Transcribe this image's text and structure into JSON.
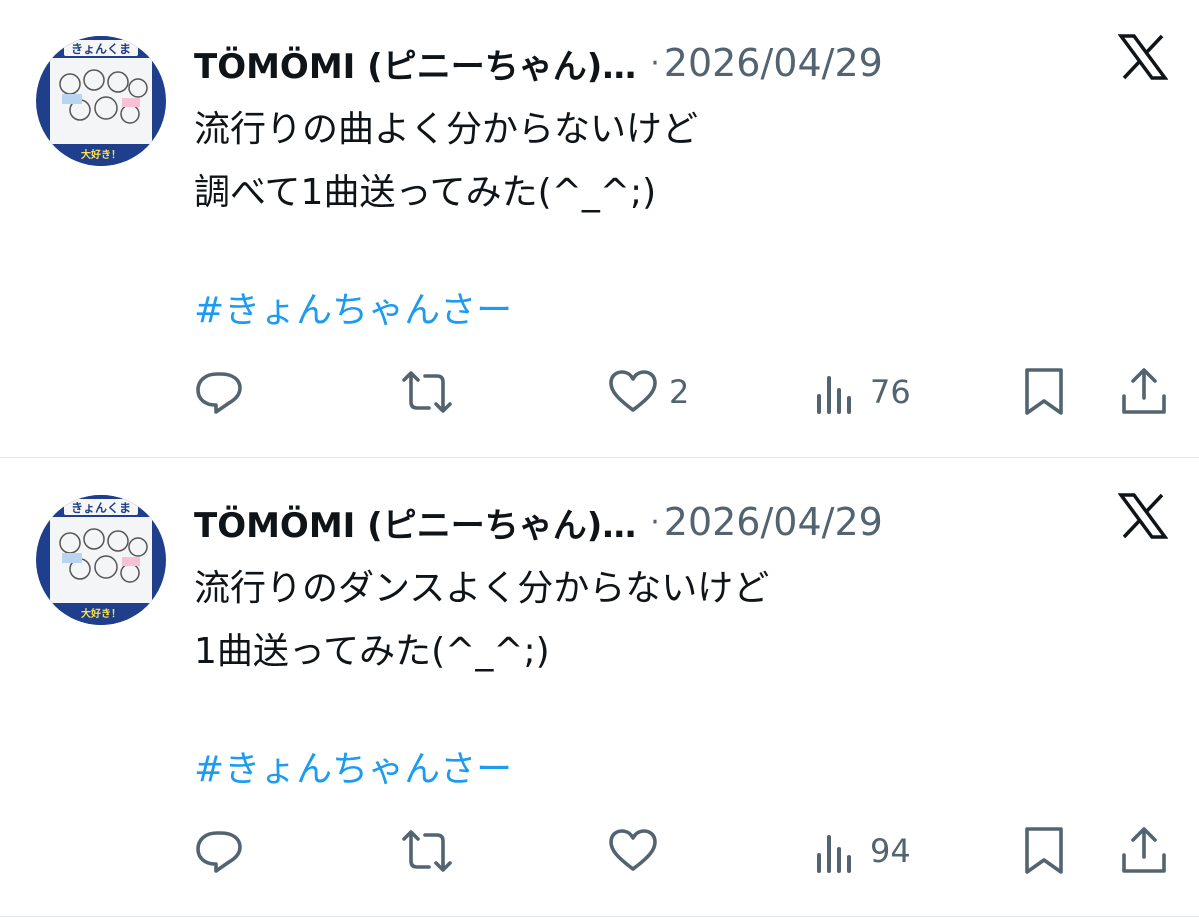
{
  "colors": {
    "text": "#0f1419",
    "secondary": "#536471",
    "hashtag": "#1d9bf0",
    "divider": "#e6e8ea"
  },
  "posts": [
    {
      "author": "TÖMÖMI (ピニーちゃん)…",
      "separator": "·",
      "date": "2026/04/29",
      "lines": [
        "流行りの曲よく分からないけど",
        "調べて1曲送ってみた(^_^;)"
      ],
      "hashtag": "#きょんちゃんさー",
      "avatar": {
        "top_text": "きょんくま",
        "bottom_text": "大好き！"
      },
      "likes": "2",
      "views": "76",
      "icons": [
        "reply-icon",
        "repost-icon",
        "like-icon",
        "views-icon",
        "bookmark-icon",
        "share-icon",
        "x-logo-icon"
      ]
    },
    {
      "author": "TÖMÖMI (ピニーちゃん)…",
      "separator": "·",
      "date": "2026/04/29",
      "lines": [
        "流行りのダンスよく分からないけど",
        "1曲送ってみた(^_^;)"
      ],
      "hashtag": "#きょんちゃんさー",
      "avatar": {
        "top_text": "きょんくま",
        "bottom_text": "大好き！"
      },
      "likes": "",
      "views": "94",
      "icons": [
        "reply-icon",
        "repost-icon",
        "like-icon",
        "views-icon",
        "bookmark-icon",
        "share-icon",
        "x-logo-icon"
      ]
    }
  ]
}
